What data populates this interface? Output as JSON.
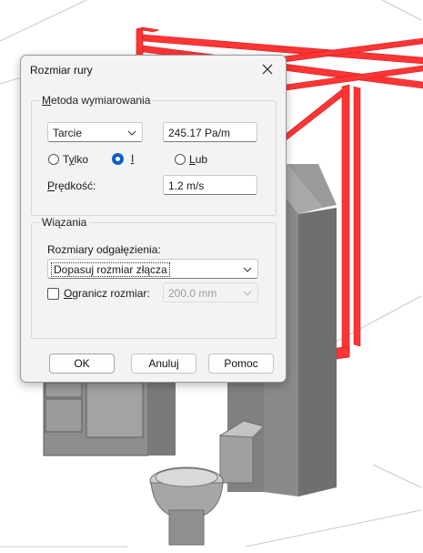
{
  "dialog": {
    "title": "Rozmiar rury",
    "method_group": {
      "legend_first": "M",
      "legend_rest": "etoda wymiarowania",
      "method_select": "Tarcie",
      "friction_value": "245.17 Pa/m",
      "radio_only_pre": "T",
      "radio_only_u": "y",
      "radio_only_post": "lko",
      "radio_and": "I",
      "radio_or_u": "L",
      "radio_or_rest": "ub",
      "selected_radio": "I",
      "velocity_label_u": "P",
      "velocity_label_rest": "rędkość:",
      "velocity_value": "1.2 m/s"
    },
    "constraints_group": {
      "legend": "Wiązania",
      "branch_sizes_label": "Rozmiary odgałęzienia:",
      "branch_sizes_value": "Dopasuj rozmiar złącza",
      "limit_checkbox_u": "O",
      "limit_checkbox_rest": "granicz rozmiar:",
      "limit_checked": false,
      "limit_value": "200.0 mm"
    },
    "buttons": {
      "ok": "OK",
      "cancel": "Anuluj",
      "help": "Pomoc"
    }
  },
  "colors": {
    "pipe": "#ff3434",
    "cabinet": "#858585",
    "accent": "#0a5fc8",
    "dialog_bg": "#f3f3f3"
  },
  "icons": [
    "close-icon",
    "chevron-down-icon"
  ]
}
